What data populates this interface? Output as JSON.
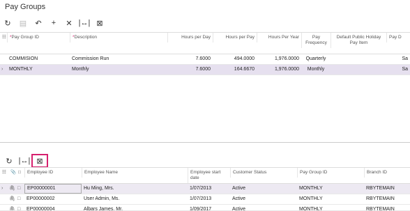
{
  "page_title": "Pay Groups",
  "top_toolbar": {
    "icons": [
      "refresh-icon",
      "save-icon",
      "undo-icon",
      "plus-icon",
      "close-icon",
      "fit-columns-icon",
      "export-icon"
    ]
  },
  "top_grid": {
    "headers": {
      "pay_group_id": "Pay Group ID",
      "description": "Description",
      "hours_per_day": "Hours per Day",
      "hours_per_pay": "Hours per Pay",
      "hours_per_year": "Hours Per Year",
      "pay_frequency": "Pay Frequency",
      "holiday_pay_item": "Default Public Holiday Pay Item",
      "pay_d": "Pay D"
    },
    "rows": [
      {
        "id": "COMMISION",
        "desc": "Commission Run",
        "hpd": "7.6000",
        "hpp": "494.0000",
        "hpy": "1,976.0000",
        "freq": "Quarterly",
        "item": "",
        "payd": "Sa"
      },
      {
        "id": "MONTHLY",
        "desc": "Monthly",
        "hpd": "7.6000",
        "hpp": "164.6670",
        "hpy": "1,976.0000",
        "freq": "Monthly",
        "item": "",
        "payd": "Sa"
      }
    ]
  },
  "bottom_grid": {
    "headers": {
      "employee_id": "Employee ID",
      "employee_name": "Employee Name",
      "start_date": "Employee start date",
      "status": "Customer Status",
      "pay_group_id": "Pay Group ID",
      "branch_id": "Branch ID"
    },
    "rows": [
      {
        "id": "EP00000001",
        "name": "Hu Ming, Mrs.",
        "date": "1/07/2013",
        "status": "Active",
        "pg": "MONTHLY",
        "branch": "RBYTEMAIN"
      },
      {
        "id": "EP00000002",
        "name": "User Admin, Ms.",
        "date": "1/07/2013",
        "status": "Active",
        "pg": "MONTHLY",
        "branch": "RBYTEMAIN"
      },
      {
        "id": "EP00000004",
        "name": "Albars James, Mr.",
        "date": "1/09/2017",
        "status": "Active",
        "pg": "MONTHLY",
        "branch": "RBYTEMAIN"
      }
    ]
  },
  "colors": {
    "accent": "#d6206e",
    "selected_row": "#e6e0ef"
  }
}
